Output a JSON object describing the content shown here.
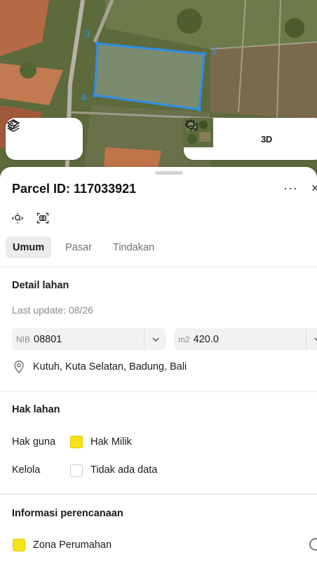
{
  "map": {
    "vertex_labels": [
      "3",
      "4",
      "1"
    ],
    "parcel_color": "#2e8fe8",
    "controls": {
      "layers": "layers-icon",
      "draw": "ruler-draw-icon",
      "satellite_thumb": "satellite-thumbnail",
      "locate": "crosshair-icon",
      "mode_3d": "3D",
      "feedback": "chat-icon"
    }
  },
  "sheet": {
    "title": "Parcel ID: 117033921",
    "more": "···",
    "close": "×"
  },
  "tabs": [
    {
      "label": "Umum",
      "active": true
    },
    {
      "label": "Pasar",
      "active": false
    },
    {
      "label": "Tindakan",
      "active": false
    }
  ],
  "detail": {
    "title": "Detail lahan",
    "last_update": "Last update: 08/26",
    "nib_prefix": "NIB",
    "nib_value": "08801",
    "area_prefix": "m2",
    "area_value": "420.0",
    "address": "Kutuh, Kuta Selatan, Badung, Bali"
  },
  "rights": {
    "title": "Hak lahan",
    "rows": [
      {
        "label": "Hak guna",
        "value": "Hak Milik",
        "swatch": "#f7e21a"
      },
      {
        "label": "Kelola",
        "value": "Tidak ada data",
        "swatch": "#ffffff"
      }
    ]
  },
  "planning": {
    "title": "Informasi perencanaan",
    "zone": "Zona Perumahan",
    "zone_color": "#f7e21a"
  }
}
